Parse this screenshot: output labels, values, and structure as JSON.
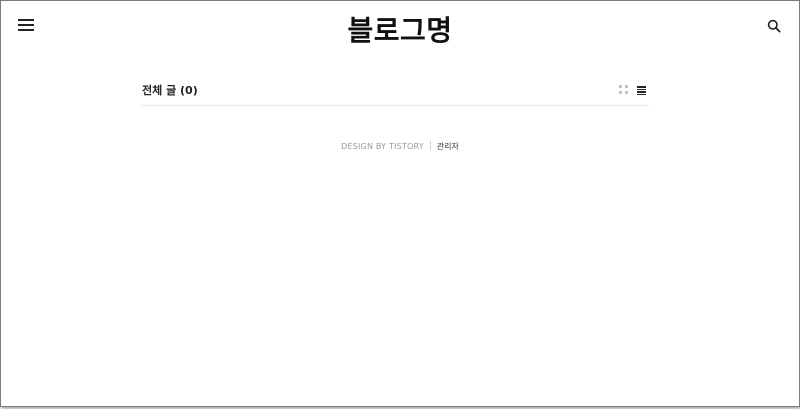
{
  "header": {
    "blog_title": "블로그명",
    "menu_icon": "hamburger-menu-icon",
    "search_icon": "search-icon"
  },
  "content": {
    "list_title": "전체 글 (0)",
    "view_toggle": {
      "grid_icon": "grid-view-icon",
      "list_icon": "list-view-icon",
      "active": "list"
    }
  },
  "footer": {
    "design_credit": "DESIGN BY TISTORY",
    "admin_link": "관리자"
  }
}
